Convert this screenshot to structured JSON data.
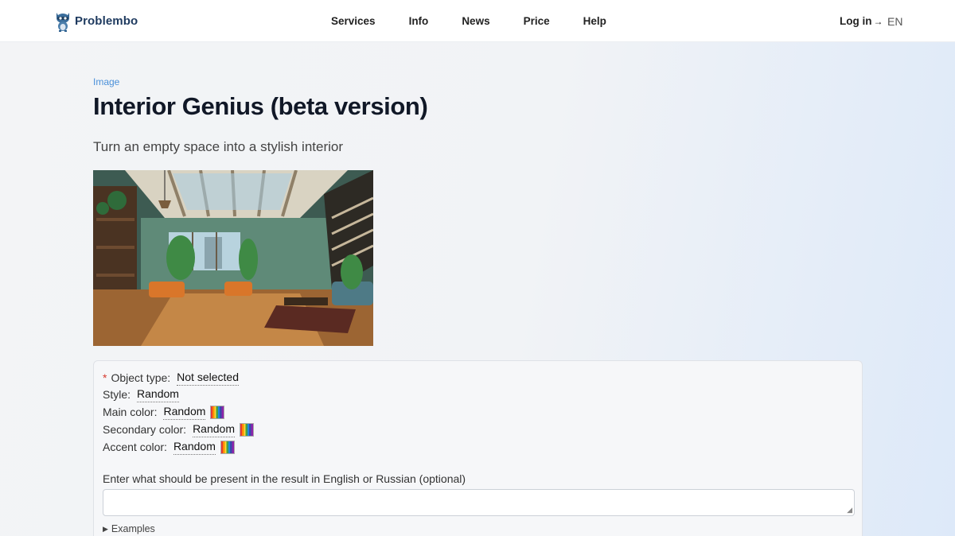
{
  "brand": {
    "name": "Problembo",
    "logo_icon": "raccoon-logo-icon"
  },
  "nav": {
    "items": [
      {
        "label": "Services"
      },
      {
        "label": "Info"
      },
      {
        "label": "News"
      },
      {
        "label": "Price"
      },
      {
        "label": "Help"
      }
    ],
    "login_label": "Log in",
    "login_icon": "login-arrow-icon",
    "language": "EN"
  },
  "page": {
    "breadcrumb": "Image",
    "title": "Interior Genius (beta version)",
    "subtitle": "Turn an empty space into a stylish interior"
  },
  "form": {
    "required_mark": "*",
    "object_type": {
      "label": "Object type:",
      "value": "Not selected"
    },
    "style": {
      "label": "Style:",
      "value": "Random"
    },
    "main_color": {
      "label": "Main color:",
      "value": "Random",
      "icon": "rainbow-swatch-icon"
    },
    "secondary_color": {
      "label": "Secondary color:",
      "value": "Random",
      "icon": "rainbow-swatch-icon"
    },
    "accent_color": {
      "label": "Accent color:",
      "value": "Random",
      "icon": "rainbow-swatch-icon"
    },
    "prompt": {
      "label": "Enter what should be present in the result in English or Russian (optional)",
      "value": "",
      "placeholder": ""
    },
    "examples_label": "Examples"
  },
  "colors": {
    "accent": "#4a90d9",
    "required": "#d63a2f",
    "title": "#111827"
  }
}
